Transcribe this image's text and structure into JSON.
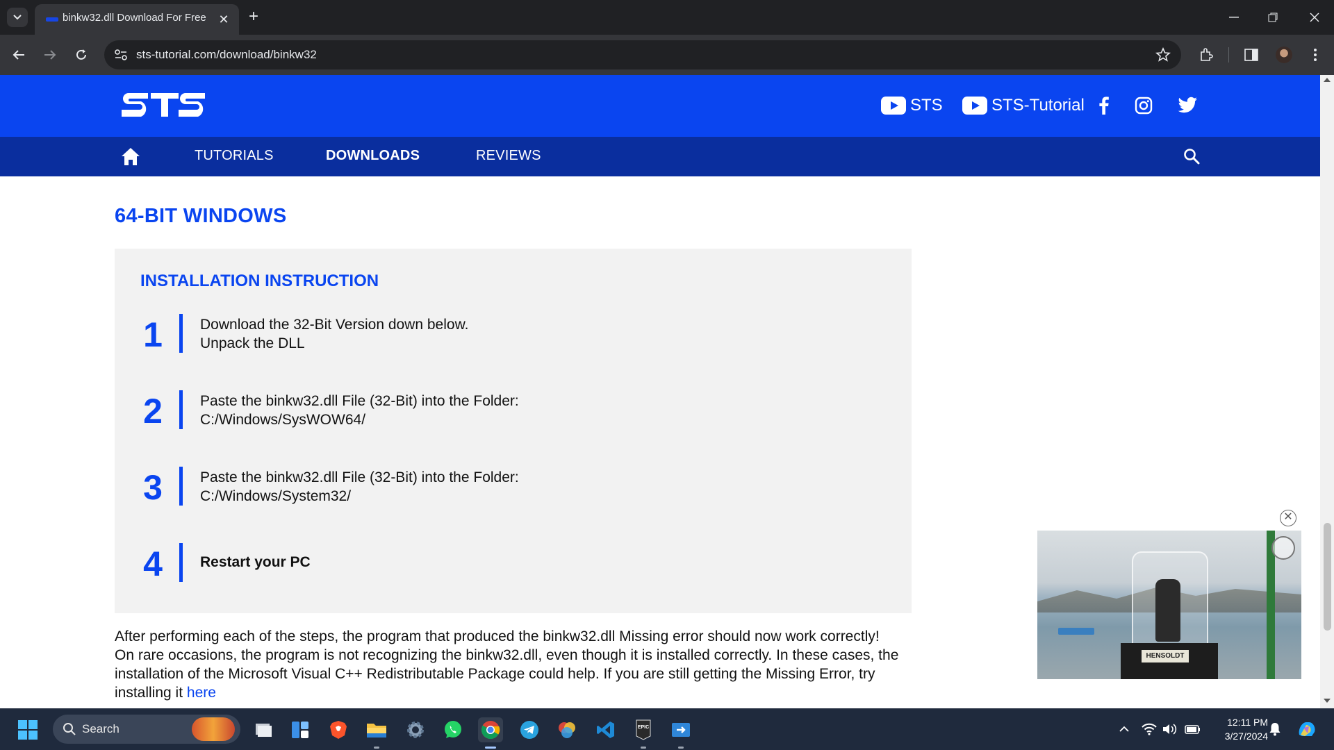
{
  "browser": {
    "tab_title": "binkw32.dll Download For Free",
    "url": "sts-tutorial.com/download/binkw32"
  },
  "site": {
    "logo_text": "STS",
    "social": [
      {
        "name": "youtube-sts",
        "label": "STS"
      },
      {
        "name": "youtube-sts-tutorial",
        "label": "STS-Tutorial"
      }
    ],
    "nav": [
      {
        "label": "TUTORIALS",
        "active": false
      },
      {
        "label": "DOWNLOADS",
        "active": true
      },
      {
        "label": "REVIEWS",
        "active": false
      }
    ],
    "colors": {
      "brand_blue": "#0a45f0",
      "nav_dark_blue": "#0a2e9e",
      "box_bg": "#f2f2f2"
    }
  },
  "content": {
    "section_title": "64-BIT WINDOWS",
    "instruction_title": "INSTALLATION INSTRUCTION",
    "steps": [
      {
        "num": "1",
        "line1": "Download the 32-Bit Version down below.",
        "line2": "Unpack the DLL"
      },
      {
        "num": "2",
        "line1": "Paste the binkw32.dll File (32-Bit) into the Folder:",
        "line2": "C:/Windows/SysWOW64/"
      },
      {
        "num": "3",
        "line1": "Paste the binkw32.dll File (32-Bit) into the Folder:",
        "line2": "C:/Windows/System32/"
      },
      {
        "num": "4",
        "line1": "Restart your PC",
        "line2": ""
      }
    ],
    "paragraph1": "After performing each of the steps, the program that produced the binkw32.dll Missing error should now work correctly!",
    "paragraph2": "On rare occasions,  the program is not recognizing the binkw32.dll, even though it is installed correctly. In these cases, the installation of the Microsoft Visual C++ Redistributable Package could help. If you are still getting the Missing Error, try installing it ",
    "paragraph2_link": "here"
  },
  "ad": {
    "plate_text": "HENSOLDT",
    "close_label": "✕"
  },
  "taskbar": {
    "search_label": "Search",
    "apps": [
      "file-explorer-widget",
      "task-view",
      "brave",
      "file-explorer",
      "settings",
      "whatsapp",
      "chrome",
      "telegram",
      "davinci",
      "vscode",
      "epic-games",
      "remote-app"
    ],
    "time": "12:11 PM",
    "date": "3/27/2024"
  }
}
